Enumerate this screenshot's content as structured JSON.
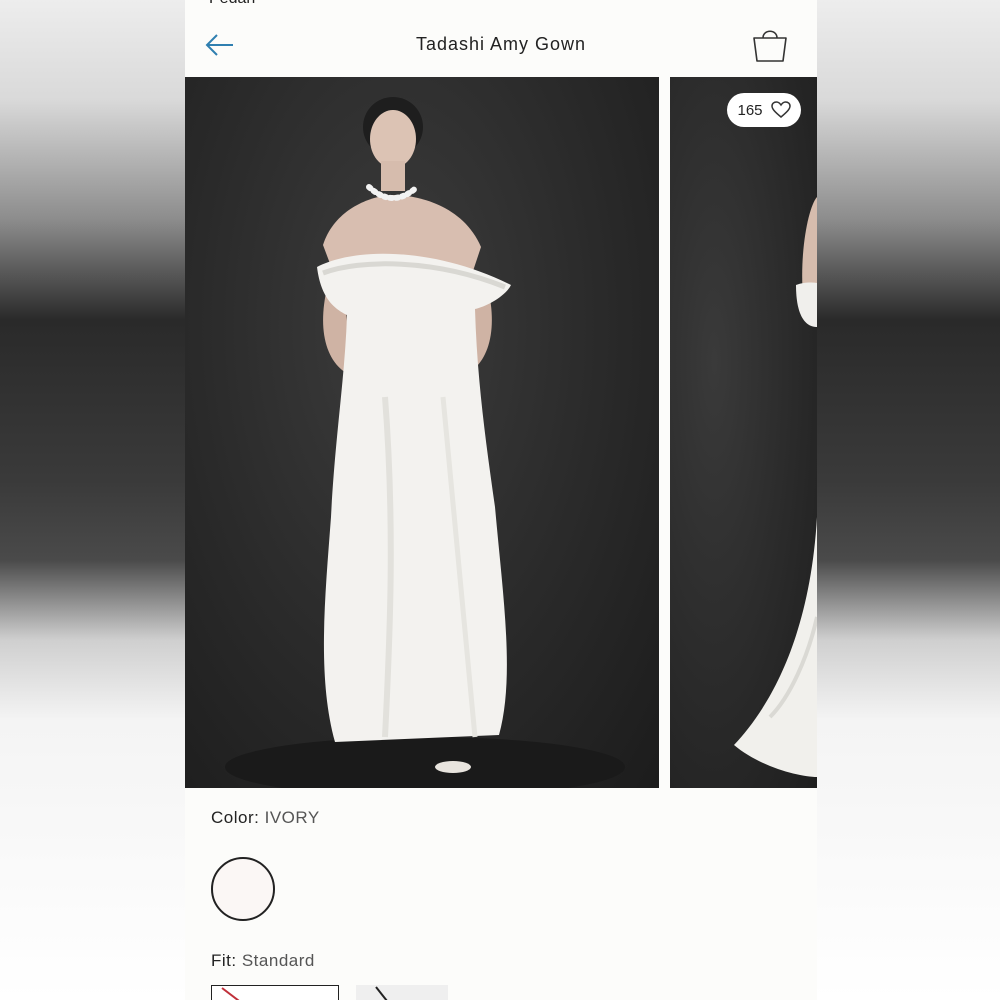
{
  "status": {
    "cut_text": "Pedan"
  },
  "header": {
    "title": "Tadashi Amy Gown"
  },
  "gallery": {
    "like_count": "165"
  },
  "color": {
    "label": "Color:",
    "value": "IVORY",
    "swatch_hex": "#fbf7f5"
  },
  "fit": {
    "label": "Fit:",
    "value": "Standard"
  },
  "colors": {
    "accent_link": "#2f7fb0",
    "text": "#222222"
  }
}
